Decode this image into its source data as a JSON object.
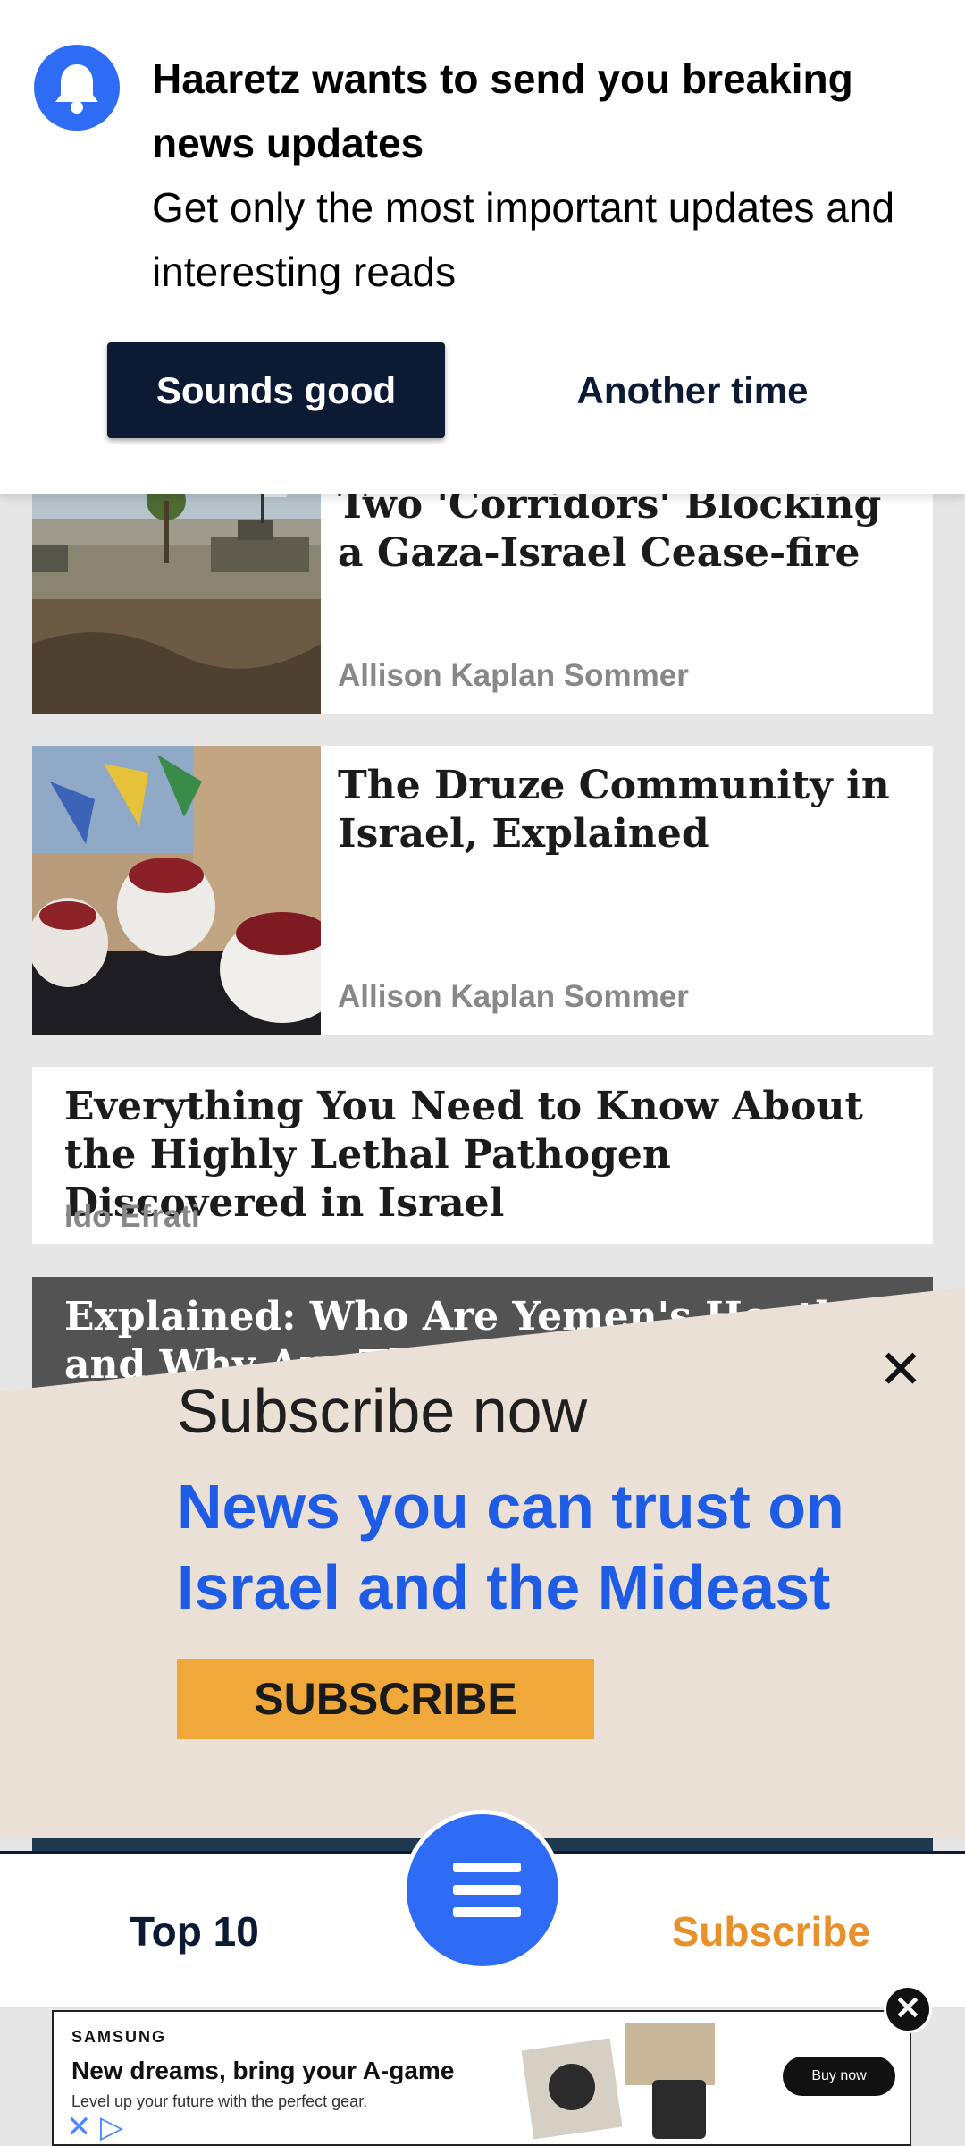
{
  "notification": {
    "title": "Haaretz wants to send you breaking news updates",
    "text": "Get only the most important updates and interesting reads",
    "accept_label": "Sounds good",
    "decline_label": "Another time"
  },
  "articles": [
    {
      "title": "Two 'Corridors' Blocking a Gaza-Israel Cease-fire",
      "author": "Allison Kaplan Sommer"
    },
    {
      "title": "The Druze Community in Israel, Explained",
      "author": "Allison Kaplan Sommer"
    },
    {
      "title": "Everything You Need to Know About the Highly Lethal Pathogen Discovered in Israel",
      "author": "Ido Efrati"
    },
    {
      "title": "Explained: Who Are Yemen's Houthis and Why Are They At"
    }
  ],
  "subscribe_overlay": {
    "heading": "Subscribe now",
    "close_label": "✕",
    "tagline": "News you can trust on Israel and the Mideast",
    "button_label": "SUBSCRIBE"
  },
  "bottom_nav": {
    "top10_label": "Top 10",
    "subscribe_label": "Subscribe",
    "menu_icon": "hamburger-menu-icon"
  },
  "ad": {
    "brand": "SAMSUNG",
    "headline": "New dreams, bring your A-game",
    "subtext": "Level up your future with the perfect gear.",
    "cta": "Buy now",
    "close_label": "✕"
  },
  "colors": {
    "brand_dark": "#0d1a33",
    "accent_blue": "#2f6cf6",
    "subscribe_orange": "#e8902a",
    "overlay_bg": "#ebe0d6",
    "subscribe_button": "#f0a83a",
    "tagline_blue": "#1f5ce6"
  }
}
